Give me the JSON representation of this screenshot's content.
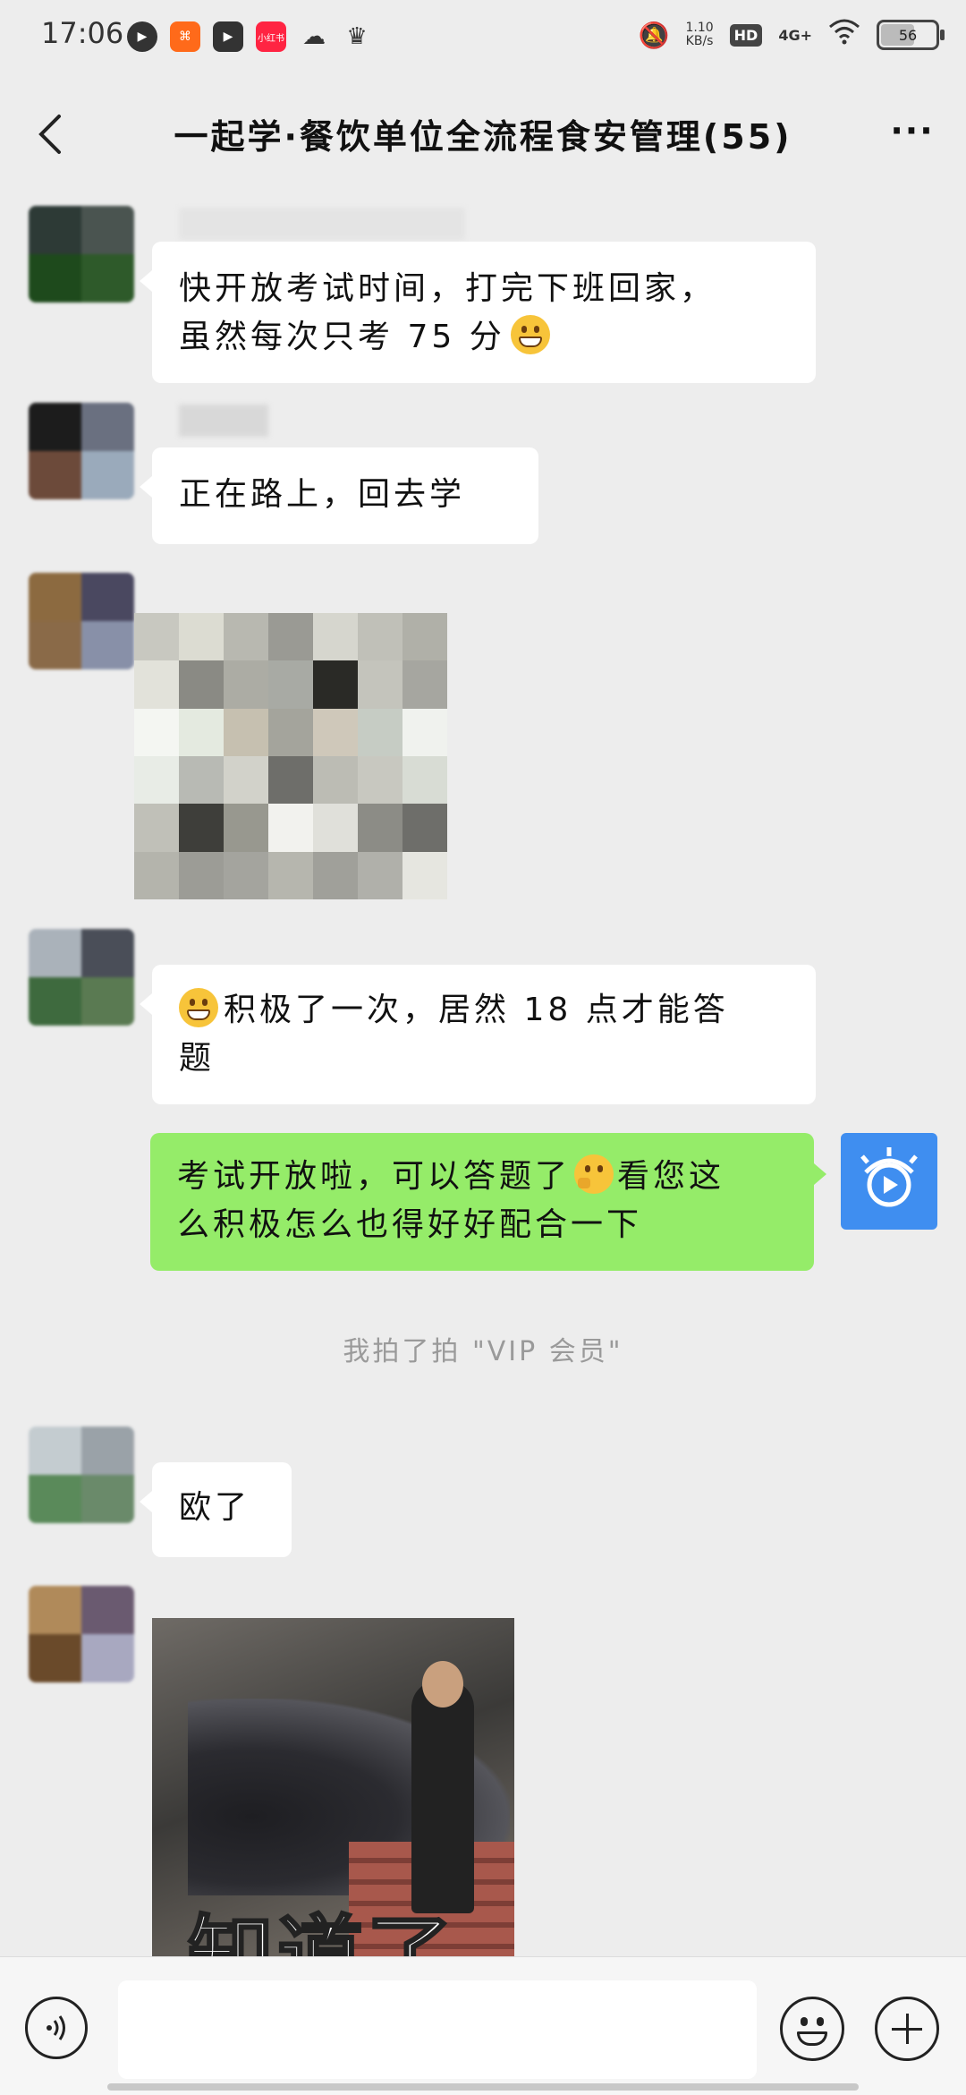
{
  "status_bar": {
    "time": "17:06",
    "net_speed_value": "1.10",
    "net_speed_unit": "KB/s",
    "hd_label": "HD",
    "network_label": "4G+",
    "battery_level": "56",
    "icons": [
      "play-icon",
      "kuaishou-icon",
      "video-icon",
      "xiaohongshu-icon",
      "chat-icon",
      "crown-icon",
      "mute-bell-icon",
      "wifi-icon"
    ]
  },
  "nav": {
    "title": "一起学·餐饮单位全流程食安管理(55)",
    "more_label": "···"
  },
  "messages": [
    {
      "side": "left",
      "text_line1": "快开放考试时间，打完下班回家，",
      "text_line2_before": "虽然每次只考 75 分"
    },
    {
      "side": "left",
      "text": "正在路上，回去学"
    },
    {
      "side": "left",
      "type": "image",
      "content": "pixelated-sticker"
    },
    {
      "side": "left",
      "text_line1_after": "积极了一次，居然 18 点才能答",
      "text_line2": "题"
    },
    {
      "side": "right",
      "text_line1_before": "考试开放啦，可以答题了",
      "text_line1_after": "看您这",
      "text_line2": "么积极怎么也得好好配合一下"
    },
    {
      "side": "left",
      "text": "欧了"
    },
    {
      "side": "left",
      "type": "image",
      "caption": "知道了"
    }
  ],
  "system_message": "我拍了拍 \"VIP 会员\"",
  "input_bar": {
    "placeholder": ""
  },
  "colors": {
    "background": "#ededed",
    "bubble_left": "#ffffff",
    "bubble_right": "#95ec69",
    "bot_avatar": "#3f8ef0"
  }
}
